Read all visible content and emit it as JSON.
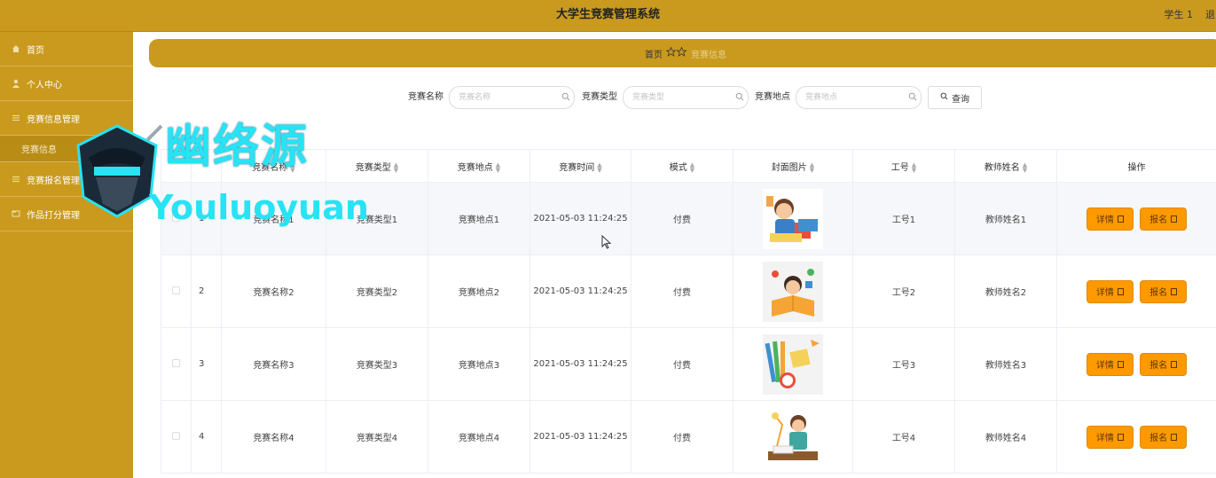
{
  "app": {
    "title": "大学生竞赛管理系统",
    "user": "学生 1",
    "logout": "退出"
  },
  "sidebar": {
    "items": [
      {
        "label": "首页",
        "icon": "home-icon"
      },
      {
        "label": "个人中心",
        "icon": "user-icon"
      },
      {
        "label": "竞赛信息管理",
        "icon": "list-icon"
      },
      {
        "label": "竞赛信息",
        "icon": "",
        "sub": true
      },
      {
        "label": "竞赛报名管理",
        "icon": "list-icon"
      },
      {
        "label": "作品打分管理",
        "icon": "folder-icon"
      }
    ]
  },
  "breadcrumb": {
    "home": "首页",
    "current": "竞赛信息"
  },
  "search": {
    "name_label": "竞赛名称",
    "name_placeholder": "竞赛名称",
    "type_label": "竞赛类型",
    "type_placeholder": "竞赛类型",
    "place_label": "竞赛地点",
    "place_placeholder": "竞赛地点",
    "button": "查询"
  },
  "table": {
    "headers": [
      "竞赛名称",
      "竞赛类型",
      "竞赛地点",
      "竞赛时间",
      "模式",
      "封面图片",
      "工号",
      "教师姓名",
      "操作"
    ],
    "rows": [
      {
        "no": "1",
        "name": "竞赛名称1",
        "type": "竞赛类型1",
        "place": "竞赛地点1",
        "time": "2021-05-03 11:24:25",
        "mode": "付费",
        "empno": "工号1",
        "teacher": "教师姓名1"
      },
      {
        "no": "2",
        "name": "竞赛名称2",
        "type": "竞赛类型2",
        "place": "竞赛地点2",
        "time": "2021-05-03 11:24:25",
        "mode": "付费",
        "empno": "工号2",
        "teacher": "教师姓名2"
      },
      {
        "no": "3",
        "name": "竞赛名称3",
        "type": "竞赛类型3",
        "place": "竞赛地点3",
        "time": "2021-05-03 11:24:25",
        "mode": "付费",
        "empno": "工号3",
        "teacher": "教师姓名3"
      },
      {
        "no": "4",
        "name": "竞赛名称4",
        "type": "竞赛类型4",
        "place": "竞赛地点4",
        "time": "2021-05-03 11:24:25",
        "mode": "付费",
        "empno": "工号4",
        "teacher": "教师姓名4"
      }
    ],
    "detail_btn": "详情",
    "signup_btn": "报名"
  },
  "watermark": {
    "cn": "幽络源",
    "en": "Youluoyuan"
  },
  "colors": {
    "primary": "#c99a1e",
    "button": "#ff9900",
    "watermark": "#27e3f4"
  }
}
